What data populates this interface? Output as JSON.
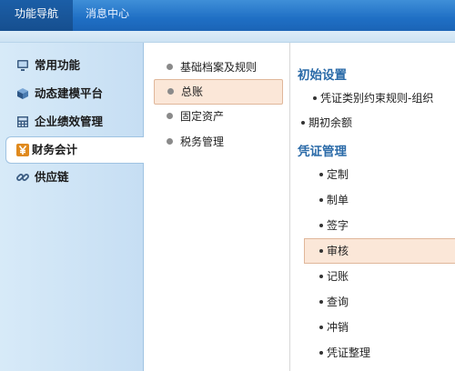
{
  "tabs": [
    {
      "label": "功能导航",
      "active": true
    },
    {
      "label": "消息中心",
      "active": false
    }
  ],
  "leftnav": {
    "items": [
      {
        "label": "常用功能",
        "icon": "monitor-icon"
      },
      {
        "label": "动态建模平台",
        "icon": "cube-icon"
      },
      {
        "label": "企业绩效管理",
        "icon": "calculator-icon"
      },
      {
        "label": "财务会计",
        "icon": "yen-icon",
        "selected": true
      },
      {
        "label": "供应链",
        "icon": "link-icon"
      }
    ]
  },
  "middle": {
    "items": [
      {
        "label": "基础档案及规则"
      },
      {
        "label": "总账",
        "selected": true
      },
      {
        "label": "固定资产"
      },
      {
        "label": "税务管理"
      }
    ]
  },
  "right": {
    "section1": {
      "title": "初始设置",
      "items": [
        {
          "label": "凭证类别约束规则-组织"
        },
        {
          "label": "期初余额"
        }
      ]
    },
    "section2": {
      "title": "凭证管理",
      "items": [
        {
          "label": "定制"
        },
        {
          "label": "制单"
        },
        {
          "label": "签字"
        },
        {
          "label": "审核",
          "selected": true
        },
        {
          "label": "记账"
        },
        {
          "label": "查询"
        },
        {
          "label": "冲销"
        },
        {
          "label": "凭证整理"
        }
      ]
    }
  },
  "colors": {
    "topbar": "#1f6fc4",
    "selection_fill": "#fbe7d8",
    "section_title": "#2a6aa8"
  }
}
